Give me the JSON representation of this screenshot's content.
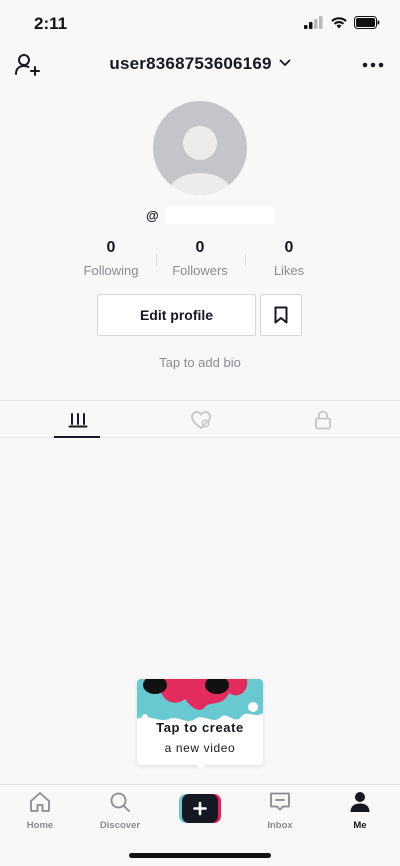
{
  "status": {
    "time": "2:11"
  },
  "header": {
    "username": "user8368753606169"
  },
  "profile": {
    "handle_prefix": "@",
    "bio_placeholder": "Tap to add bio"
  },
  "stats": [
    {
      "value": "0",
      "label": "Following"
    },
    {
      "value": "0",
      "label": "Followers"
    },
    {
      "value": "0",
      "label": "Likes"
    }
  ],
  "actions": {
    "edit_profile_label": "Edit profile"
  },
  "create_card": {
    "line1": "Tap to create",
    "line2": "a new video"
  },
  "bottom_nav": {
    "home": "Home",
    "discover": "Discover",
    "inbox": "Inbox",
    "me": "Me"
  },
  "colors": {
    "accent_red": "#ee1d52",
    "accent_cyan": "#69c9d0",
    "text_primary": "#161823",
    "text_secondary": "#8a8b91"
  }
}
